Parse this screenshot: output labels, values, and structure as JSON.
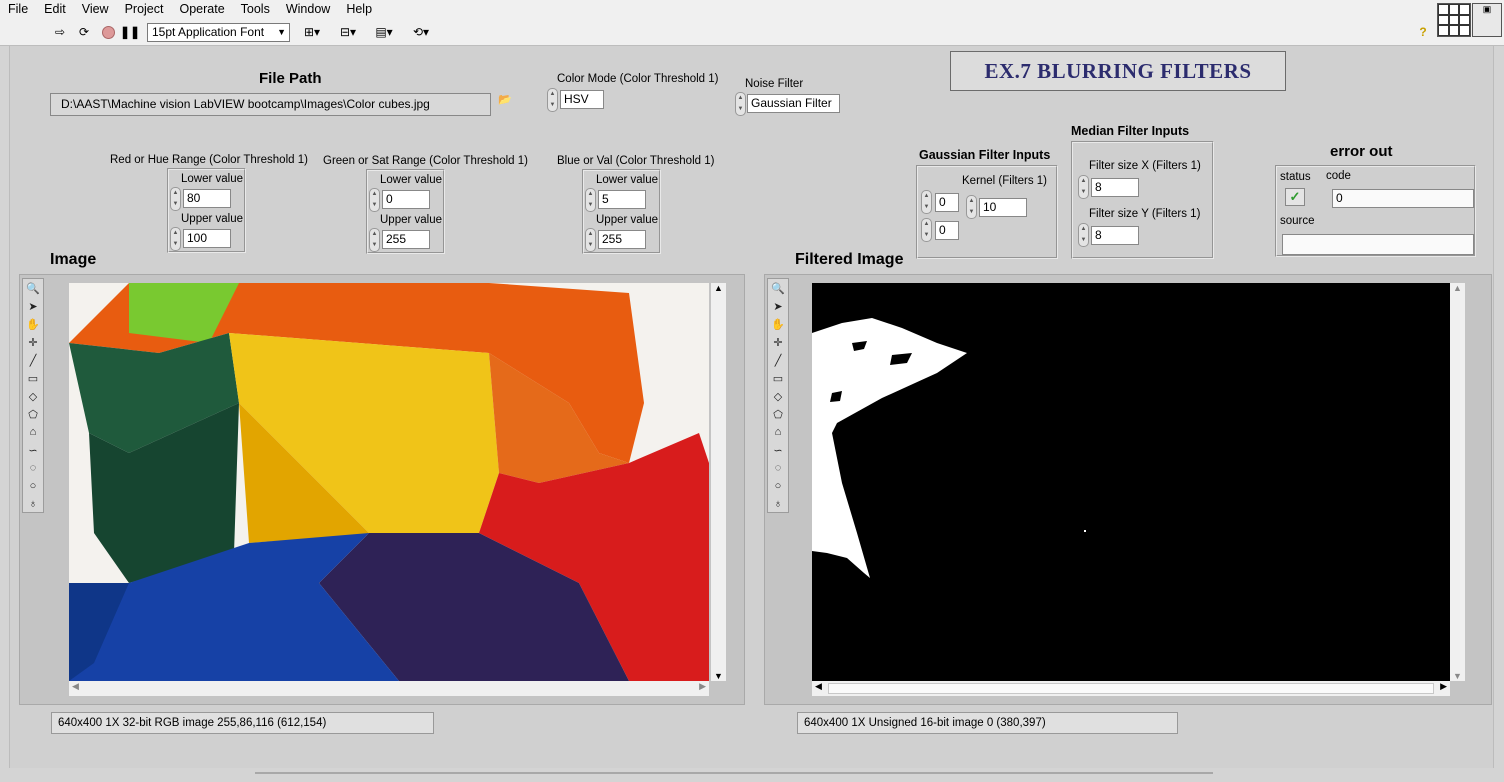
{
  "menu": [
    "File",
    "Edit",
    "View",
    "Project",
    "Operate",
    "Tools",
    "Window",
    "Help"
  ],
  "toolbar": {
    "font": "15pt Application Font"
  },
  "title_banner": "EX.7 BLURRING FILTERS",
  "file_path": {
    "label": "File Path",
    "value": "D:\\AAST\\Machine vision LabVIEW bootcamp\\Images\\Color cubes.jpg"
  },
  "color_mode": {
    "label": "Color Mode (Color Threshold 1)",
    "value": "HSV"
  },
  "noise_filter": {
    "label": "Noise Filter",
    "value": "Gaussian Filter"
  },
  "red_range": {
    "label": "Red or Hue Range (Color Threshold 1)",
    "lower_label": "Lower value",
    "lower": "80",
    "upper_label": "Upper value",
    "upper": "100"
  },
  "green_range": {
    "label": "Green or Sat Range (Color Threshold 1)",
    "lower_label": "Lower value",
    "lower": "0",
    "upper_label": "Upper value",
    "upper": "255"
  },
  "blue_range": {
    "label": "Blue or Val  (Color Threshold 1)",
    "lower_label": "Lower value",
    "lower": "5",
    "upper_label": "Upper value",
    "upper": "255"
  },
  "gaussian": {
    "title": "Gaussian Filter Inputs",
    "kernel_label": "Kernel (Filters 1)",
    "kernel": "10",
    "idx0": "0",
    "idx1": "0"
  },
  "median": {
    "title": "Median Filter Inputs",
    "x_label": "Filter size X (Filters 1)",
    "x": "8",
    "y_label": "Filter size Y (Filters 1)",
    "y": "8"
  },
  "error_out": {
    "title": "error out",
    "status_label": "status",
    "code_label": "code",
    "code": "0",
    "source_label": "source",
    "source": ""
  },
  "image": {
    "label": "Image",
    "status": "640x400 1X 32-bit RGB image 255,86,116     (612,154)"
  },
  "filtered": {
    "label": "Filtered Image",
    "status": "640x400 1X Unsigned 16-bit image 0     (380,397)"
  },
  "colors": {
    "panel": "#d0d0d0",
    "title": "#2c2c6e",
    "ok": "#2e9b2e"
  }
}
